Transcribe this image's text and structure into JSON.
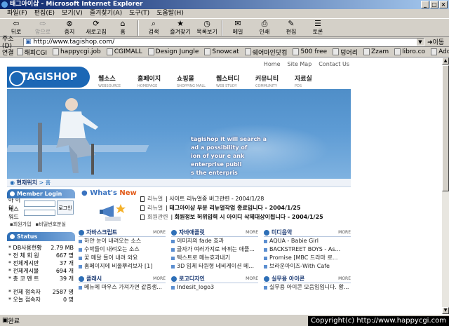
{
  "window": {
    "title": "태그아이샵 - Microsoft Internet Explorer",
    "buttons": [
      "_",
      "□",
      "×"
    ]
  },
  "menu": [
    "파일(F)",
    "편집(E)",
    "보기(V)",
    "즐겨찾기(A)",
    "도구(T)",
    "도움말(H)"
  ],
  "toolbar": [
    {
      "label": "뒤로",
      "icon": "⇦",
      "disabled": false
    },
    {
      "label": "앞으로",
      "icon": "⇨",
      "disabled": true
    },
    {
      "label": "중지",
      "icon": "⊗",
      "disabled": false
    },
    {
      "label": "새로고침",
      "icon": "⟳",
      "disabled": false
    },
    {
      "label": "홈",
      "icon": "⌂",
      "disabled": false
    },
    {
      "label": "검색",
      "icon": "⌕",
      "disabled": false
    },
    {
      "label": "즐겨찾기",
      "icon": "★",
      "disabled": false
    },
    {
      "label": "목록보기",
      "icon": "◷",
      "disabled": false
    },
    {
      "label": "메일",
      "icon": "✉",
      "disabled": false
    },
    {
      "label": "인쇄",
      "icon": "⎙",
      "disabled": false
    },
    {
      "label": "편집",
      "icon": "✎",
      "disabled": false
    },
    {
      "label": "토론",
      "icon": "☰",
      "disabled": false
    }
  ],
  "address": {
    "label": "주소(D)",
    "url": "http://www.tagishop.com/",
    "go": "이동"
  },
  "links": {
    "label": "연결",
    "items": [
      "해피CGI",
      "happycgi.job",
      "CGIMALL",
      "Design Jungle",
      "Snowcat",
      "쉐어마인닷컴",
      "500 free",
      "덩어리",
      "Zzam",
      "libro.co",
      "Adobe"
    ]
  },
  "site": {
    "logo": "TAGISHOP",
    "toplinks": [
      "Home",
      "Site Map",
      "Contact Us"
    ],
    "nav": [
      {
        "k": "웹소스",
        "e": "WEBSOURCE"
      },
      {
        "k": "홈페이지",
        "e": "HOMEPAGE"
      },
      {
        "k": "쇼핑몰",
        "e": "SHOPPING MALL"
      },
      {
        "k": "웹스터디",
        "e": "WEB STUDY"
      },
      {
        "k": "커뮤니티",
        "e": "COMMUNITY"
      },
      {
        "k": "자료실",
        "e": "PDS"
      }
    ],
    "hero_text": [
      "tagishop it will search a",
      "ad a possibility of",
      "ion of your e",
      "enterprise publi",
      "s the enterpris",
      "im",
      "ank"
    ],
    "breadcrumb": {
      "label": "현재위치",
      "value": "홈"
    },
    "login": {
      "title": "Member Login",
      "id_label": "아 이 디",
      "pw_label": "패스워드",
      "button": "로그인",
      "join": "회원가입",
      "find": "비밀번호분실"
    },
    "status": {
      "title": "Status",
      "rows": [
        {
          "k": "* DB사용현황",
          "v": "2.79 MB"
        },
        {
          "k": "* 전 체 회 원",
          "v": "667 명"
        },
        {
          "k": "* 전체게시판",
          "v": "37 개"
        },
        {
          "k": "* 전체게시물",
          "v": "694 개"
        },
        {
          "k": "* 총 코 멘 트",
          "v": "39 개"
        },
        {
          "k": "",
          "v": ""
        },
        {
          "k": "* 전체 접속자",
          "v": "2587 명"
        },
        {
          "k": "* 오늘 접속자",
          "v": "0 명"
        }
      ]
    },
    "whats_new": {
      "a": "What's",
      "b": "New"
    },
    "news": [
      {
        "cat": "리뉴얼",
        "t": "사이트 리뉴얼중 버그관련 - 2004/1/28",
        "b": false
      },
      {
        "cat": "리뉴얼",
        "t": "태그아이샵 부분 리뉴얼작업 종료입니다 - 2004/1/25",
        "b": true
      },
      {
        "cat": "회원관련",
        "t": "회원정보 허위입력 시 아이디 삭제대상이됩니다 - 2004/1/25",
        "b": true
      }
    ],
    "sections": [
      {
        "title": "자바스크립트",
        "more": "MORE",
        "items": [
          "하얀 눈이 내려오는 소스",
          "수박들이 내려오는 소스",
          "꽃 메달 들이 내려 와요",
          "홈페이지에 비올뿌려보자 [1]"
        ]
      },
      {
        "title": "자바애플릿",
        "more": "MORE",
        "items": [
          "이미지의 fade 효과",
          "글자가 여러가지로 바뀌는 애플...",
          "텍스트로 메뉴효과내기",
          "3D 입체 타원형 네비게이션 메..."
        ]
      },
      {
        "title": "미디음악",
        "more": "MORE",
        "items": [
          "AQUA - Babie Girl",
          "BACKSTREET BOYS - As...",
          "Promise [MBC 드라마 로...",
          "브라운아이즈-With Cafe"
        ]
      },
      {
        "title": "플래시",
        "more": "MORE",
        "items": [
          "메뉴에 마우스 가져가면 같중생..."
        ]
      },
      {
        "title": "로고디자인",
        "more": "MORE",
        "items": [
          "Indesit_logo3"
        ]
      },
      {
        "title": "실무용 아이콘",
        "more": "MORE",
        "items": [
          "실무용 아이콘 모음입입니다. 황..."
        ]
      }
    ]
  },
  "statusbar": {
    "text": "완료",
    "copyright": "Copyright(c) http://www.happycgi.com"
  }
}
